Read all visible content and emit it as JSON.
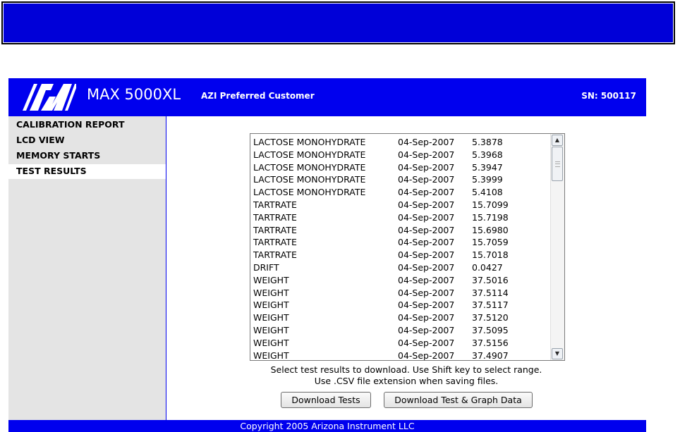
{
  "header": {
    "model": "MAX 5000XL",
    "customer": "AZI Preferred Customer",
    "serial": "SN: 500117"
  },
  "sidebar": {
    "items": [
      {
        "label": "CALIBRATION REPORT",
        "active": false
      },
      {
        "label": "LCD VIEW",
        "active": false
      },
      {
        "label": "MEMORY STARTS",
        "active": false
      },
      {
        "label": "TEST RESULTS",
        "active": true
      }
    ]
  },
  "results": {
    "rows": [
      [
        "LACTOSE MONOHYDRATE",
        "04-Sep-2007",
        "5.3878"
      ],
      [
        "LACTOSE MONOHYDRATE",
        "04-Sep-2007",
        "5.3968"
      ],
      [
        "LACTOSE MONOHYDRATE",
        "04-Sep-2007",
        "5.3947"
      ],
      [
        "LACTOSE MONOHYDRATE",
        "04-Sep-2007",
        "5.3999"
      ],
      [
        "LACTOSE MONOHYDRATE",
        "04-Sep-2007",
        "5.4108"
      ],
      [
        "TARTRATE",
        "04-Sep-2007",
        "15.7099"
      ],
      [
        "TARTRATE",
        "04-Sep-2007",
        "15.7198"
      ],
      [
        "TARTRATE",
        "04-Sep-2007",
        "15.6980"
      ],
      [
        "TARTRATE",
        "04-Sep-2007",
        "15.7059"
      ],
      [
        "TARTRATE",
        "04-Sep-2007",
        "15.7018"
      ],
      [
        "DRIFT",
        "04-Sep-2007",
        "0.0427"
      ],
      [
        "WEIGHT",
        "04-Sep-2007",
        "37.5016"
      ],
      [
        "WEIGHT",
        "04-Sep-2007",
        "37.5114"
      ],
      [
        "WEIGHT",
        "04-Sep-2007",
        "37.5117"
      ],
      [
        "WEIGHT",
        "04-Sep-2007",
        "37.5120"
      ],
      [
        "WEIGHT",
        "04-Sep-2007",
        "37.5095"
      ],
      [
        "WEIGHT",
        "04-Sep-2007",
        "37.5156"
      ],
      [
        "WEIGHT",
        "04-Sep-2007",
        "37.4907"
      ]
    ]
  },
  "instructions": {
    "line1": "Select test results to download. Use Shift key to select range.",
    "line2": "Use .CSV file extension when saving files."
  },
  "buttons": {
    "download_tests": "Download Tests",
    "download_graph": "Download Test & Graph Data"
  },
  "footer": {
    "copyright": "Copyright 2005 Arizona Instrument LLC"
  },
  "colors": {
    "brand_blue": "#0000ee",
    "top_bar_blue": "#0000d8",
    "sidebar_bg": "#e4e4e4"
  }
}
